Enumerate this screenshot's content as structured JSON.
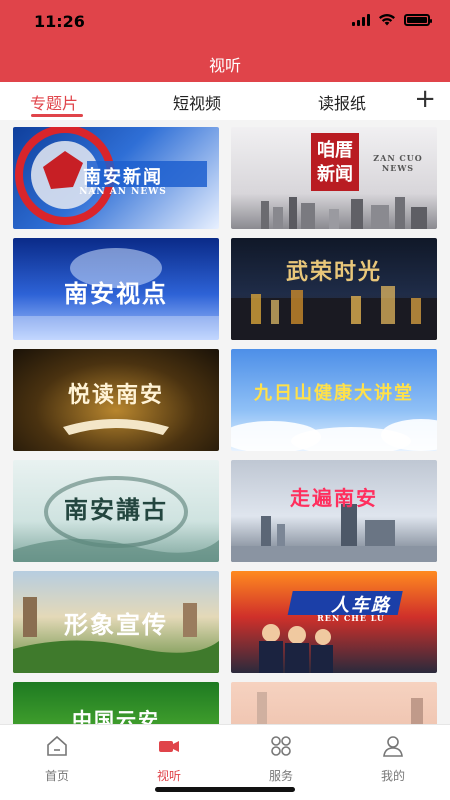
{
  "status": {
    "time": "11:26"
  },
  "header": {
    "title": "视听"
  },
  "tabs": [
    {
      "label": "专题片",
      "active": true
    },
    {
      "label": "短视频",
      "active": false
    },
    {
      "label": "读报纸",
      "active": false
    }
  ],
  "add_tab_icon": "plus-icon",
  "cards": [
    {
      "title": "南安新闻",
      "subtitle": "NAN AN NEWS"
    },
    {
      "title": "咱厝新闻",
      "subtitle": "ZAN CUO NEWS"
    },
    {
      "title": "南安视点",
      "subtitle": ""
    },
    {
      "title": "武荣时光",
      "subtitle": ""
    },
    {
      "title": "悦读南安",
      "subtitle": ""
    },
    {
      "title": "九日山健康大讲堂",
      "subtitle": ""
    },
    {
      "title": "南安講古",
      "subtitle": ""
    },
    {
      "title": "走遍南安",
      "subtitle": ""
    },
    {
      "title": "形象宣传",
      "subtitle": ""
    },
    {
      "title": "人车路",
      "subtitle": "REN CHE LU"
    },
    {
      "title": "中国云安",
      "subtitle": ""
    },
    {
      "title": "",
      "subtitle": ""
    }
  ],
  "tabbar": [
    {
      "label": "首页",
      "icon": "home-icon",
      "active": false
    },
    {
      "label": "视听",
      "icon": "video-icon",
      "active": true
    },
    {
      "label": "服务",
      "icon": "grid-icon",
      "active": false
    },
    {
      "label": "我的",
      "icon": "user-icon",
      "active": false
    }
  ],
  "colors": {
    "accent": "#e0444a"
  }
}
